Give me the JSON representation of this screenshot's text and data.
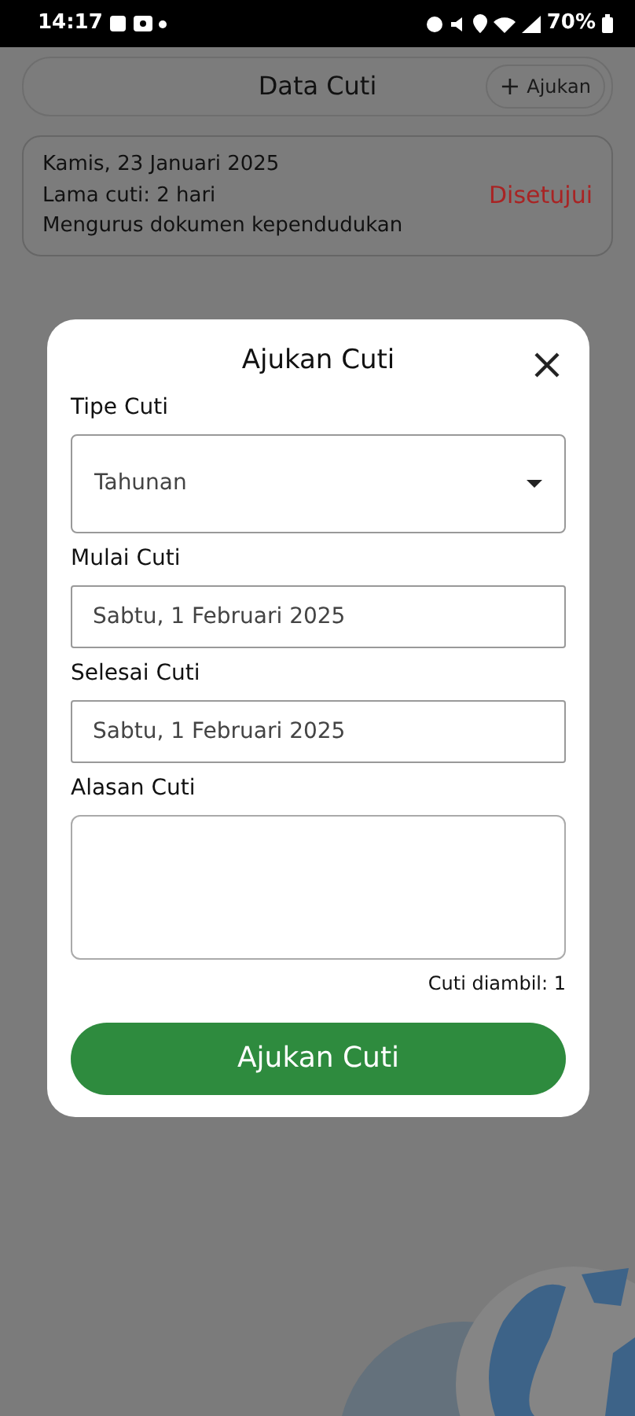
{
  "status_bar": {
    "time": "14:17",
    "battery": "70%"
  },
  "header": {
    "title": "Data Cuti",
    "add_button": {
      "icon": "+",
      "label": "Ajukan"
    }
  },
  "leave_list": [
    {
      "date": "Kamis, 23 Januari 2025",
      "duration": "Lama cuti: 2 hari",
      "reason": "Mengurus dokumen kependudukan",
      "status": "Disetujui",
      "color": "#a82424"
    }
  ],
  "dialog": {
    "title": "Ajukan Cuti",
    "fields": [
      {
        "kind": "select",
        "label": "Tipe Cuti",
        "value": "Tahunan"
      },
      {
        "kind": "text",
        "label": "Mulai Cuti",
        "value": "Sabtu, 1 Februari 2025"
      },
      {
        "kind": "text",
        "label": "Selesai Cuti",
        "value": "Sabtu, 1 Februari 2025"
      },
      {
        "kind": "textarea",
        "label": "Alasan Cuti"
      }
    ],
    "days_taken": "Cuti diambil: 1",
    "submit_button": "Ajukan Cuti"
  }
}
